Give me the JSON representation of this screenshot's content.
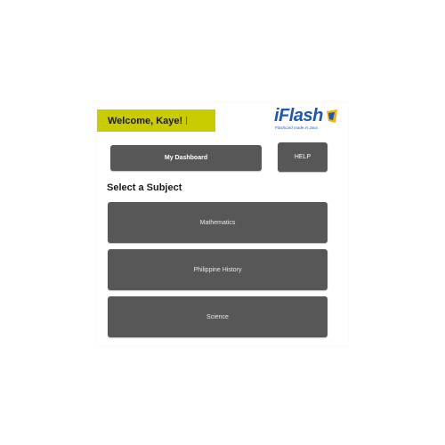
{
  "header": {
    "welcome_text": "Welcome, Kaye!",
    "accent_color": "#c9cc00"
  },
  "logo": {
    "name": "iFlash",
    "tagline": "Flashcard made in Java",
    "brand_color": "#1f57b8",
    "mark_color": "#f2b705"
  },
  "nav": {
    "dashboard_label": "My Dashboard",
    "help_label": "HELP",
    "button_color": "#575757"
  },
  "subjects": {
    "title": "Select a Subject",
    "items": [
      {
        "label": "Mathematics"
      },
      {
        "label": "Philippine History"
      },
      {
        "label": "Science"
      }
    ]
  }
}
